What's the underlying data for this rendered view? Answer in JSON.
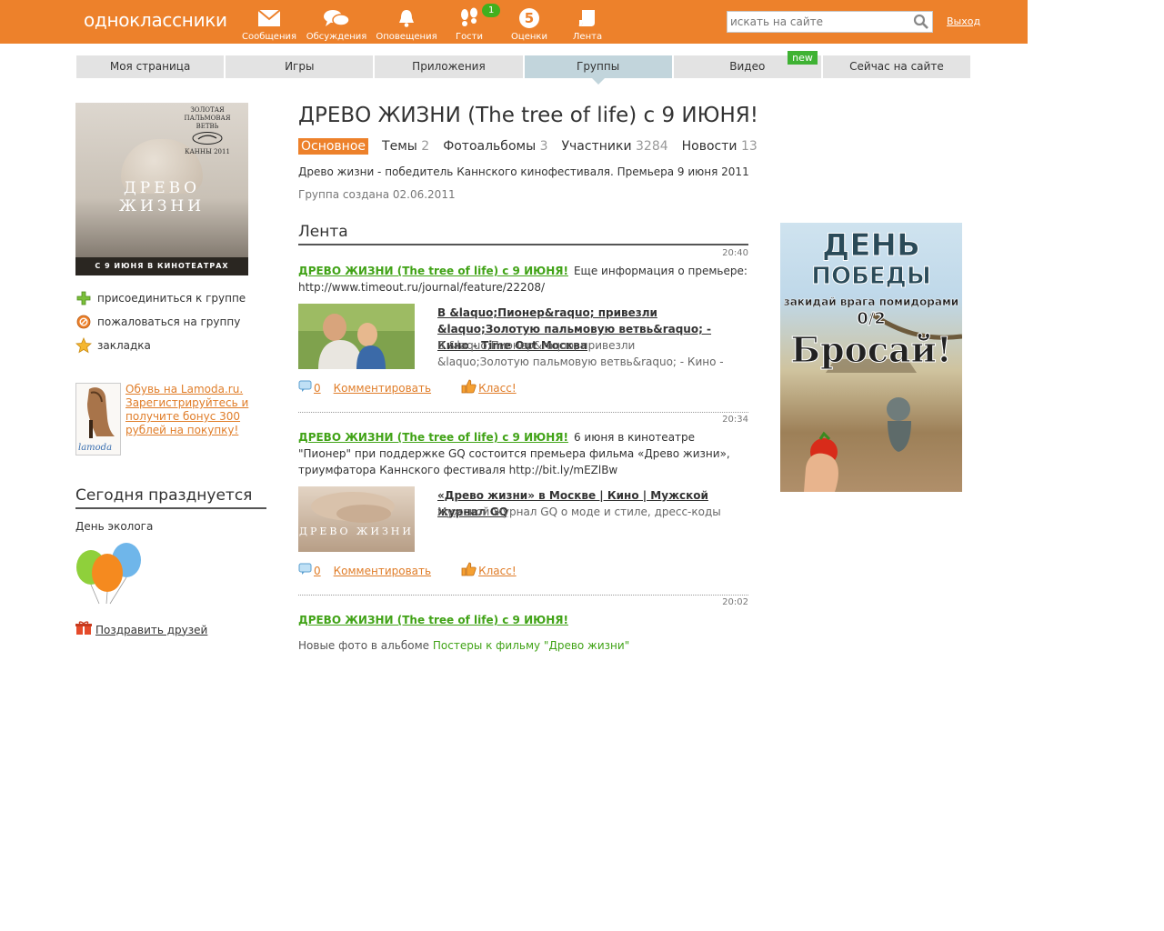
{
  "header": {
    "logo": "одноклассники",
    "nav": [
      {
        "label": "Сообщения",
        "icon": "envelope-icon"
      },
      {
        "label": "Обсуждения",
        "icon": "chat-bubbles-icon"
      },
      {
        "label": "Оповещения",
        "icon": "bell-icon"
      },
      {
        "label": "Гости",
        "icon": "footprints-icon",
        "badge": "1"
      },
      {
        "label": "Оценки",
        "icon": "rating-circle-icon",
        "value": "5"
      },
      {
        "label": "Лента",
        "icon": "feed-icon"
      }
    ],
    "search_placeholder": "искать на сайте",
    "logout": "Выход"
  },
  "tabs": [
    {
      "label": "Моя страница"
    },
    {
      "label": "Игры"
    },
    {
      "label": "Приложения"
    },
    {
      "label": "Группы",
      "active": true
    },
    {
      "label": "Видео",
      "flag": "new"
    },
    {
      "label": "Сейчас на сайте"
    }
  ],
  "poster": {
    "cannes_text": "ЗОЛОТАЯ ПАЛЬМОВАЯ ВЕТВЬ",
    "cannes_year": "КАННЫ 2011",
    "title_line1": "ДРЕВО",
    "title_line2": "ЖИЗНИ",
    "strip": "С 9 ИЮНЯ В КИНОТЕАТРАХ"
  },
  "sidebar_links": [
    {
      "label": "присоединиться к группе",
      "icon": "plus-icon"
    },
    {
      "label": "пожаловаться на группу",
      "icon": "complaint-icon"
    },
    {
      "label": "закладка",
      "icon": "star-icon"
    }
  ],
  "left_ad": {
    "text": "Обувь на Lamoda.ru. Зарегистрируйтесь и получите бонус 300 рублей на покупку!",
    "brand": "lamoda"
  },
  "today": {
    "heading": "Сегодня празднуется",
    "event": "День эколога",
    "congrats": "Поздравить друзей"
  },
  "group": {
    "title": "ДРЕВО ЖИЗНИ (The tree of life) с 9 ИЮНЯ!",
    "subtabs": [
      {
        "label": "Основное",
        "count": "",
        "active": true
      },
      {
        "label": "Темы",
        "count": "2"
      },
      {
        "label": "Фотоальбомы",
        "count": "3"
      },
      {
        "label": "Участники",
        "count": "3284"
      },
      {
        "label": "Новости",
        "count": "13"
      }
    ],
    "description": "Древо жизни - победитель Каннского кинофестиваля. Премьера 9 июня 2011",
    "created": "Группа создана 02.06.2011"
  },
  "feed": {
    "heading": "Лента",
    "posts": [
      {
        "time": "20:40",
        "group_link": "ДРЕВО ЖИЗНИ (The tree of life) с 9 ИЮНЯ!",
        "text": "Еще информация о премьере: http://www.timeout.ru/journal/feature/22208/",
        "link_title": "В &laquo;Пионер&raquo; привезли &laquo;Золотую пальмовую ветвь&raquo; - Кино - Time Out Москва",
        "link_desc": "В &laquo;Пионер&raquo; привезли &laquo;Золотую пальмовую ветвь&raquo; - Кино -",
        "comments": "0",
        "comment_label": "Комментировать",
        "like_label": "Класс!"
      },
      {
        "time": "20:34",
        "group_link": "ДРЕВО ЖИЗНИ (The tree of life) с 9 ИЮНЯ!",
        "text": "6 июня в кинотеатре \"Пионер\" при поддержке GQ состоится премьера фильма «Древо жизни», триумфатора Каннского фестиваля http://bit.ly/mEZlBw",
        "link_title": "«Древо жизни» в Москве | Кино | Мужской журнал GQ",
        "link_desc": "Мужской журнал GQ о моде и стиле, дресс-коды",
        "thumb_text": "ДРЕВО ЖИЗНИ",
        "comments": "0",
        "comment_label": "Комментировать",
        "like_label": "Класс!"
      },
      {
        "time": "20:02",
        "group_link": "ДРЕВО ЖИЗНИ (The tree of life) с 9 ИЮНЯ!",
        "new_photo_prefix": "Новые фото в альбоме",
        "new_photo_album": "Постеры к фильму \"Древо жизни\""
      }
    ]
  },
  "right_ad": {
    "line1": "ДЕНЬ",
    "line2": "ПОБЕДЫ",
    "line3": "закидай врага помидорами",
    "line4": "0/2",
    "line5": "Бросай!"
  },
  "colors": {
    "brand_orange": "#ed812b",
    "link_green": "#41a317",
    "link_orange": "#e07d29",
    "active_tab": "#c2d5dc"
  }
}
